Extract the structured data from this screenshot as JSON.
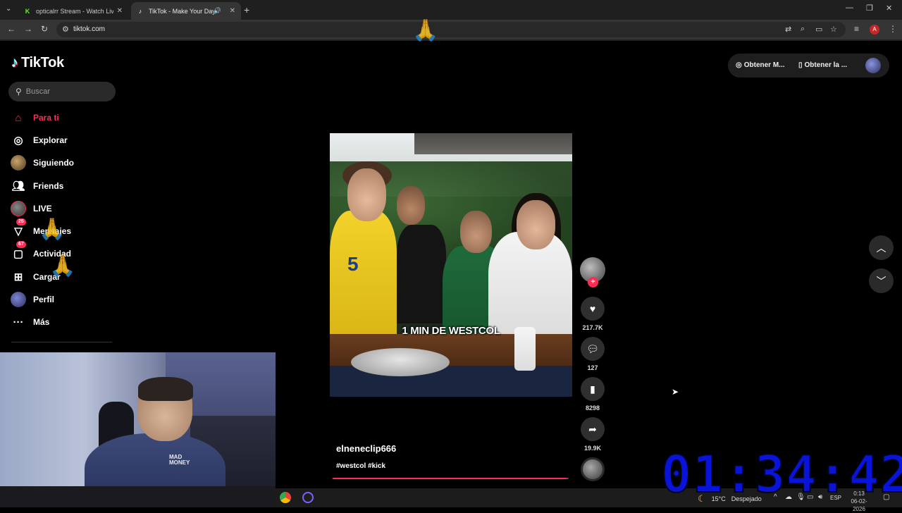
{
  "browser": {
    "tabs": [
      {
        "title": "opticalrr Stream - Watch Live o",
        "favicon": "kick-icon",
        "active": false
      },
      {
        "title": "TikTok - Make Your Day",
        "favicon": "tiktok-icon",
        "active": true
      }
    ],
    "new_tab": "+",
    "url": "tiktok.com"
  },
  "tiktok": {
    "logo_text": "TikTok",
    "search_placeholder": "Buscar",
    "nav": [
      {
        "label": "Para ti",
        "icon": "home-icon",
        "active": true
      },
      {
        "label": "Explorar",
        "icon": "compass-icon"
      },
      {
        "label": "Siguiendo",
        "icon": "avatar"
      },
      {
        "label": "Friends",
        "icon": "friends-icon"
      },
      {
        "label": "LIVE",
        "icon": "live-avatar"
      },
      {
        "label": "Mensajes",
        "icon": "send-icon",
        "badge": "25"
      },
      {
        "label": "Actividad",
        "icon": "inbox-icon",
        "badge": "67"
      },
      {
        "label": "Cargar",
        "icon": "upload-icon"
      },
      {
        "label": "Perfil",
        "icon": "profile-avatar"
      },
      {
        "label": "Más",
        "icon": "more-icon"
      }
    ],
    "header": {
      "btn1": "Obtener M...",
      "btn2": "Obtener la ..."
    },
    "video": {
      "caption_overlay": "1 MIN DE WESTCOL",
      "jersey_number": "5",
      "author": "elneneclip666",
      "tags": "#westcol #kick",
      "progress": 0.99
    },
    "actions": {
      "likes": "217.7K",
      "comments": "127",
      "saves": "8298",
      "shares": "19.9K"
    }
  },
  "webcam": {
    "shirt_text": "MAD MONEY"
  },
  "taskbar": {
    "temperature": "15°C",
    "weather": "Despejado",
    "language": "ESP",
    "time": "0:13",
    "date": "06-02-2026"
  },
  "stream_timer": "01:34:42",
  "colors": {
    "tiktok_red": "#fe2c55",
    "timer_blue": "#0a14d8"
  }
}
